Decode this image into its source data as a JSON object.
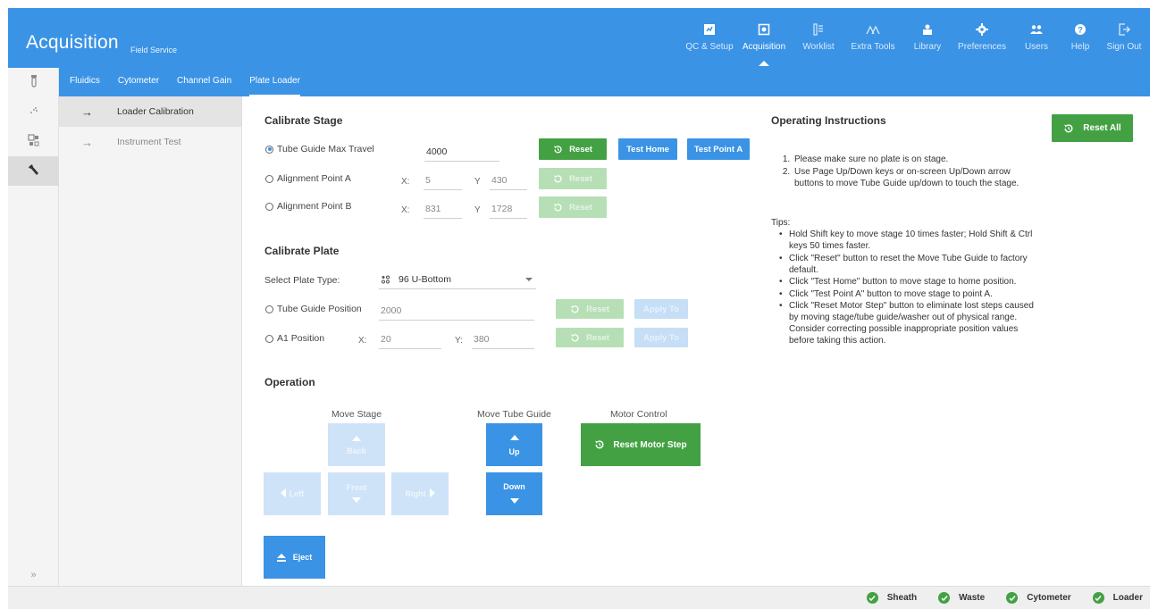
{
  "header": {
    "title": "Acquisition",
    "subtitle": "Field Service"
  },
  "nav": [
    {
      "label": "QC & Setup",
      "icon": "qc-setup-icon"
    },
    {
      "label": "Acquisition",
      "icon": "acquisition-icon",
      "active": true
    },
    {
      "label": "Worklist",
      "icon": "worklist-icon"
    },
    {
      "label": "Extra Tools",
      "icon": "extra-tools-icon"
    },
    {
      "label": "Library",
      "icon": "library-icon"
    },
    {
      "label": "Preferences",
      "icon": "preferences-icon"
    },
    {
      "label": "Users",
      "icon": "users-icon"
    },
    {
      "label": "Help",
      "icon": "help-icon"
    },
    {
      "label": "Sign Out",
      "icon": "sign-out-icon"
    }
  ],
  "subtabs": [
    "Fluidics",
    "Cytometer",
    "Channel Gain",
    "Plate Loader"
  ],
  "rail": {
    "expand": "»"
  },
  "secnav": [
    {
      "label": "Loader Calibration",
      "active": true
    },
    {
      "label": "Instrument Test"
    }
  ],
  "calibrate_stage": {
    "title": "Calibrate Stage",
    "tube_guide_label": "Tube Guide Max Travel",
    "tube_guide_value": "4000",
    "alignment_a_label": "Alignment Point A",
    "alignment_a_x": "5",
    "alignment_a_y": "430",
    "alignment_b_label": "Alignment Point B",
    "alignment_b_x": "831",
    "alignment_b_y": "1728",
    "x_label": "X:",
    "y_label": "Y",
    "reset": "Reset",
    "test_home": "Test Home",
    "test_point_a": "Test Point A"
  },
  "calibrate_plate": {
    "title": "Calibrate Plate",
    "select_label": "Select Plate Type:",
    "plate_type": "96 U-Bottom",
    "tube_guide_position_label": "Tube Guide Position",
    "tube_guide_position_value": "2000",
    "a1_label": "A1 Position",
    "a1_x": "20",
    "a1_y": "380",
    "x_label": "X:",
    "y_label": "Y:",
    "reset": "Reset",
    "apply": "Apply To"
  },
  "operation": {
    "title": "Operation",
    "move_stage": "Move Stage",
    "move_tube_guide": "Move Tube Guide",
    "motor_control": "Motor Control",
    "back": "Back",
    "front": "Front",
    "left": "Left",
    "right": "Right",
    "up": "Up",
    "down": "Down",
    "reset_motor_step": "Reset Motor Step",
    "eject": "Eject"
  },
  "instructions": {
    "title": "Operating Instructions",
    "reset_all": "Reset All",
    "steps": [
      "Please make sure no plate is on stage.",
      "Use Page Up/Down keys or on-screen Up/Down arrow buttons to move Tube Guide up/down to touch the stage."
    ],
    "tips_label": "Tips:",
    "tips": [
      "Hold Shift key to move stage 10 times faster; Hold Shift & Ctrl keys 50 times faster.",
      "Click \"Reset\" button to reset the Move Tube Guide to factory default.",
      "Click \"Test Home\" button to move stage to home position.",
      "Click \"Test Point A\" button to move stage to point A.",
      "Click \"Reset Motor Step\" button to eliminate lost steps caused by moving stage/tube guide/washer out of physical range. Consider correcting possible inappropriate position values before taking this action."
    ]
  },
  "status": [
    {
      "label": "Sheath"
    },
    {
      "label": "Waste"
    },
    {
      "label": "Cytometer"
    },
    {
      "label": "Loader"
    }
  ],
  "colors": {
    "primary": "#3a93e5",
    "success": "#43a143"
  }
}
